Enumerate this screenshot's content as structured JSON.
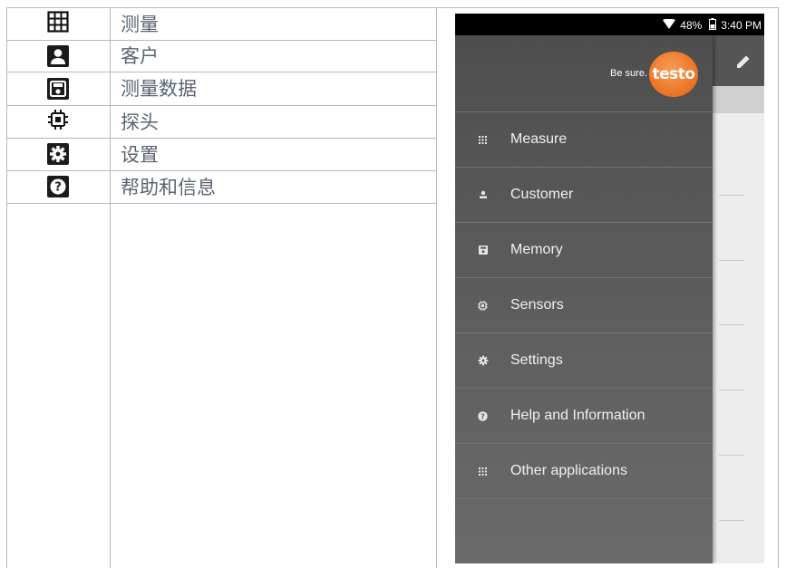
{
  "doc_table": {
    "rows": [
      {
        "icon": "measure-grid-icon",
        "label": "测量"
      },
      {
        "icon": "customer-icon",
        "label": "客户"
      },
      {
        "icon": "memory-icon",
        "label": "测量数据"
      },
      {
        "icon": "sensor-chip-icon",
        "label": "探头"
      },
      {
        "icon": "gear-icon",
        "label": "设置"
      },
      {
        "icon": "help-icon",
        "label": "帮助和信息"
      }
    ]
  },
  "phone": {
    "status": {
      "battery": "48%",
      "time": "3:40 PM"
    },
    "header": {
      "tagline": "Be sure.",
      "logo_text": "testo"
    },
    "menu": [
      {
        "icon": "grid-icon",
        "label": "Measure"
      },
      {
        "icon": "customer-icon",
        "label": "Customer"
      },
      {
        "icon": "memory-icon",
        "label": "Memory"
      },
      {
        "icon": "sensor-icon",
        "label": "Sensors"
      },
      {
        "icon": "gear-icon",
        "label": "Settings"
      },
      {
        "icon": "help-icon",
        "label": "Help and Information"
      },
      {
        "icon": "grid-icon",
        "label": "Other applications"
      }
    ]
  },
  "colors": {
    "logo_orange": "#ee7a2a",
    "drawer_gray": "#555555",
    "doc_text": "#5a6570"
  }
}
